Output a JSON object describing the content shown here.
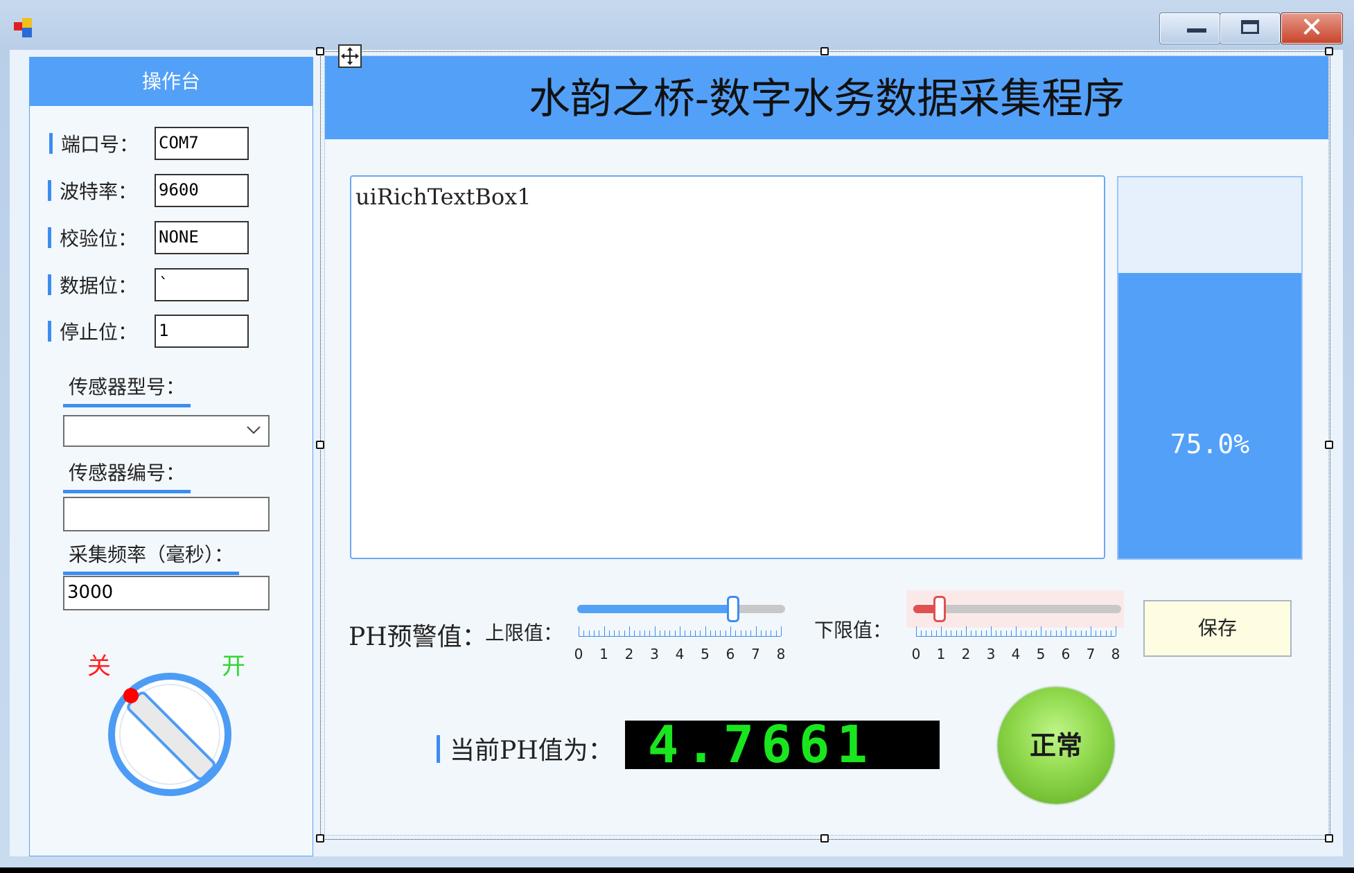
{
  "window": {
    "controls": {
      "minimize_icon": "minimize-icon",
      "maximize_icon": "maximize-icon",
      "close_glyph": "✕"
    }
  },
  "sidebar": {
    "header": "操作台",
    "fields": [
      {
        "label": "端口号：",
        "value": "COM7"
      },
      {
        "label": "波特率：",
        "value": "9600"
      },
      {
        "label": "校验位：",
        "value": "NONE"
      },
      {
        "label": "数据位：",
        "value": "`"
      },
      {
        "label": "停止位：",
        "value": "1"
      }
    ],
    "sensor_model_label": "传感器型号：",
    "sensor_model_value": "",
    "sensor_id_label": "传感器编号：",
    "sensor_id_value": "",
    "freq_label": "采集频率（毫秒）：",
    "freq_value": "3000",
    "switch": {
      "off_label": "关",
      "on_label": "开",
      "state": "off"
    }
  },
  "main": {
    "title": "水韵之桥-数字水务数据采集程序",
    "rich_text": "uiRichTextBox1",
    "progress": {
      "percent": 75.0,
      "label": "75.0%"
    },
    "ph_warning_label": "PH预警值：",
    "upper_label": "上限值：",
    "lower_label": "下限值：",
    "upper_value": 6,
    "lower_value": 1,
    "scale": {
      "min": 0,
      "max": 8,
      "labels": [
        "0",
        "1",
        "2",
        "3",
        "4",
        "5",
        "6",
        "7",
        "8"
      ]
    },
    "save_label": "保存",
    "current_ph_label": "当前PH值为：",
    "current_ph_value": "4.7661",
    "status_label": "正常",
    "colors": {
      "accent": "#53a0f8",
      "lcd_text": "#19e61e",
      "status_ok": "#8fd84b",
      "lower_slider": "#e05050"
    }
  }
}
